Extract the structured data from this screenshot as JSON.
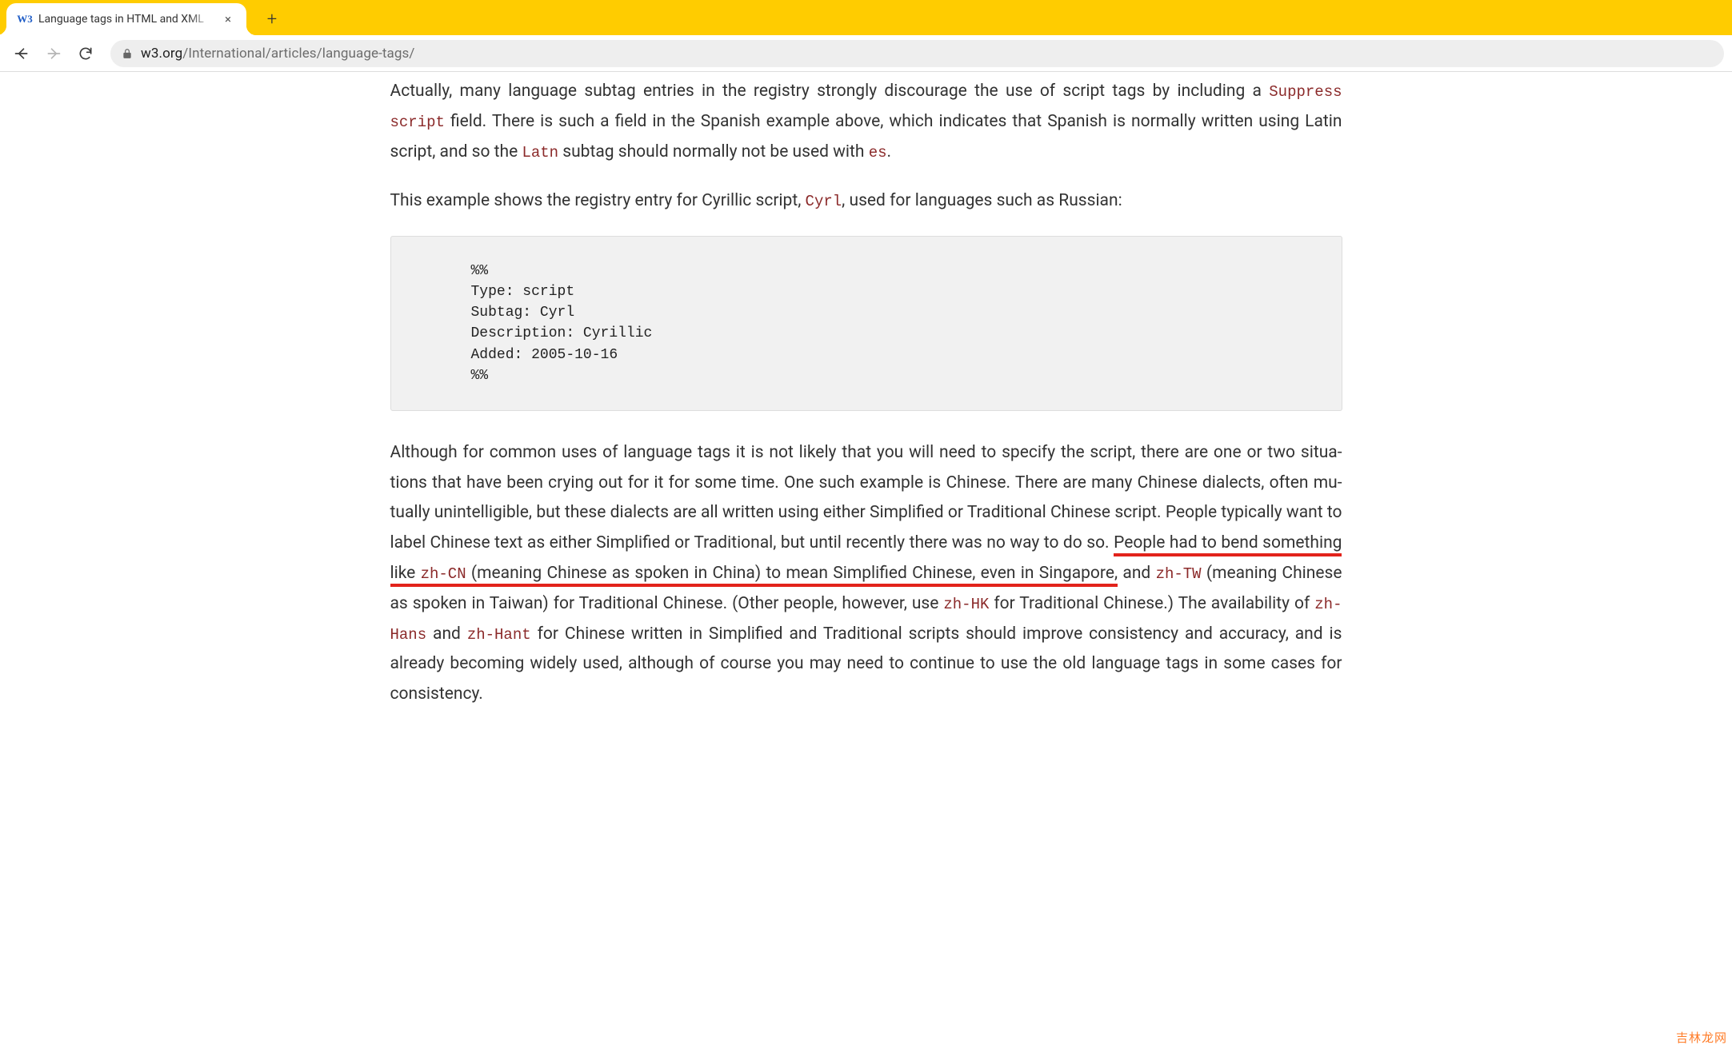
{
  "browser": {
    "tab": {
      "favicon_text": "W3",
      "title": "Language tags in HTML and XML"
    },
    "new_tab_symbol": "+",
    "tab_close_symbol": "×",
    "url": {
      "host": "w3.org",
      "path": "/International/articles/language-tags/"
    }
  },
  "article": {
    "p1": {
      "t1": "Actually, many language subtag entries in the registry strongly discourage the use of script tags by including a ",
      "c1": "Suppress script",
      "t2": " field. There is such a field in the Spanish example above, which indicates that Spanish is normally written using Latin script, and so the ",
      "c2": "Latn",
      "t3": " subtag should normally not be used with ",
      "c3": "es",
      "t4": "."
    },
    "p2": {
      "t1": "This example shows the registry entry for Cyrillic script, ",
      "c1": "Cyrl",
      "t2": ", used for languages such as Russian:"
    },
    "registry_block": "%%\nType: script\nSubtag: Cyrl\nDescription: Cyrillic\nAdded: 2005-10-16\n%%",
    "p3": {
      "t1": "Although for common uses of language tags it is not likely that you will need to specify the script, there are one or two situa­tions that have been crying out for it for some time. One such example is Chinese. There are many Chinese dialects, often mu­tually unintelligible, but these dialects are all written using either Simplified or Traditional Chinese script. People typically want to label Chinese text as either Simplified or Traditional, but until recently there was no way to do so. ",
      "u1": "People had to bend some­",
      "u2": "thing like ",
      "c1": "zh-CN",
      "u3": " (meaning Chinese as spoken in China) to mean Simplified Chinese, even in Singapore,",
      "t2": " and ",
      "c2": "zh-TW",
      "t3": " (meaning Chinese as spoken in Taiwan) for Traditional Chinese. (Other people, however, use ",
      "c3": "zh-HK",
      "t4": " for Traditional Chinese.) The availabil­ity of ",
      "c4": "zh-Hans",
      "t5": " and ",
      "c5": "zh-Hant",
      "t6": " for Chinese written in Simplified and Traditional scripts should improve consistency and accuracy, and is already becoming widely used, although of course you may need to continue to use the old language tags in some cases for consistency."
    }
  },
  "watermark": "吉林龙网"
}
